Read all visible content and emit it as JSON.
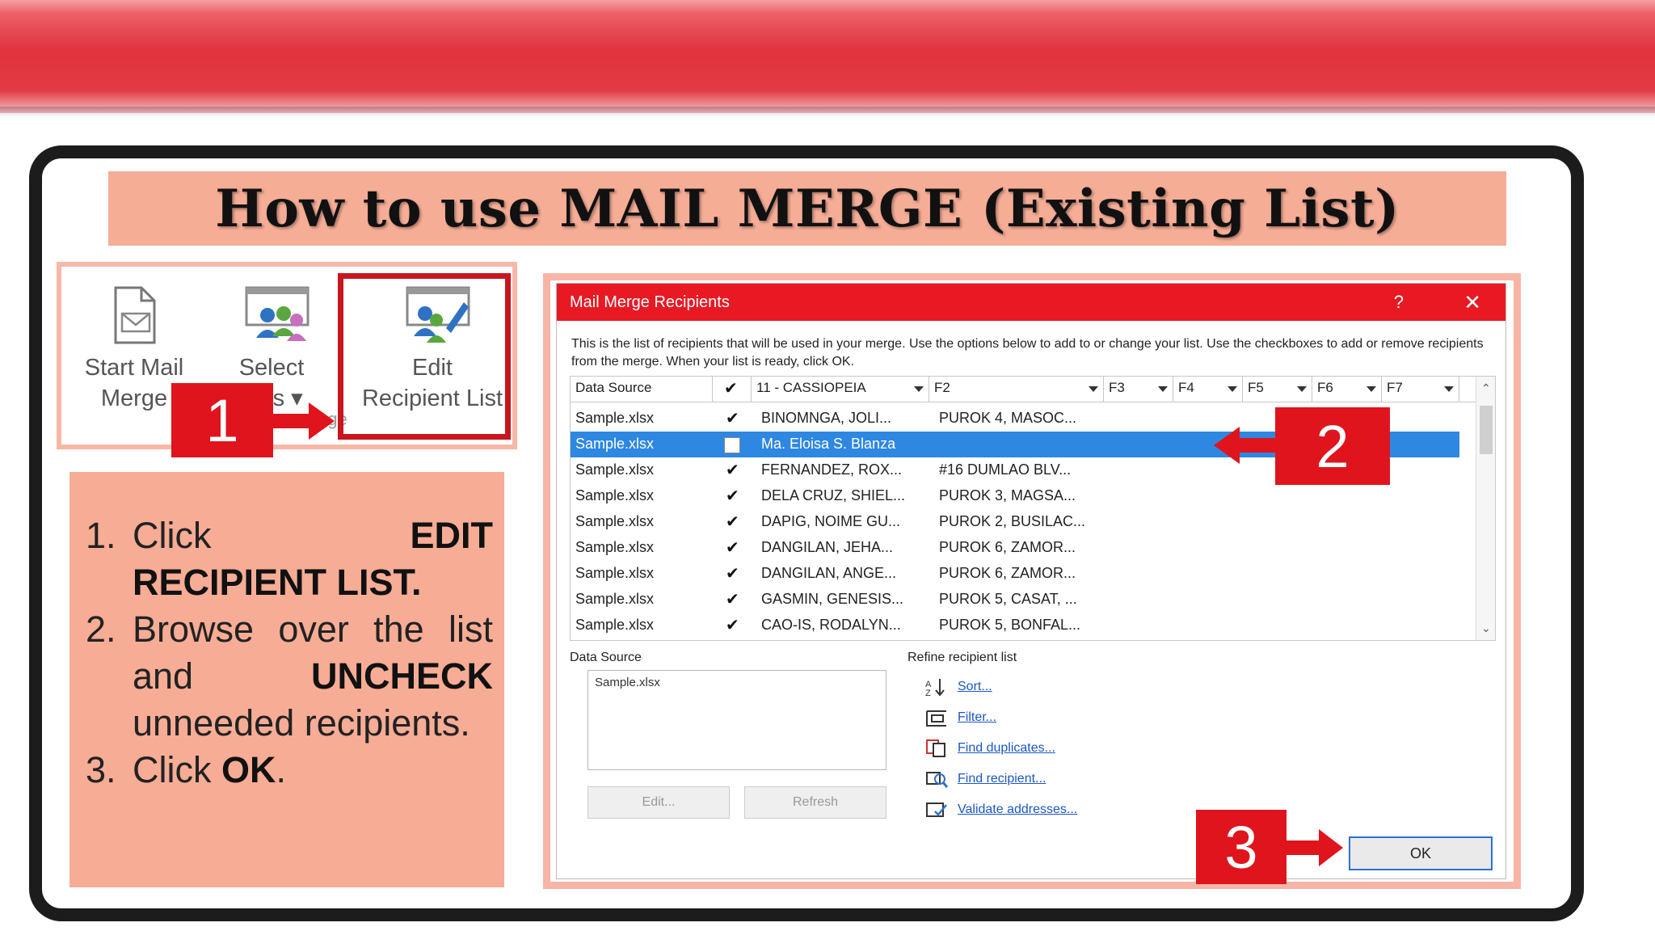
{
  "slide": {
    "title": "How to use MAIL MERGE (Existing List)"
  },
  "ribbon": {
    "start_mail_merge": [
      "Start Mail",
      "Merge"
    ],
    "select_recipients": [
      "Select",
      "ents ▾"
    ],
    "edit_recipient_list": [
      "Edit",
      "Recipient List"
    ],
    "group_label": "rge"
  },
  "callouts": {
    "one": "1",
    "two": "2",
    "three": "3"
  },
  "steps": [
    {
      "num": "1.",
      "pre": "Click ",
      "bold": "EDIT RECIPIENT LIST.",
      "post": ""
    },
    {
      "num": "2.",
      "pre": "Browse over the list and ",
      "bold": "UNCHECK",
      "post": " unneeded recipients."
    },
    {
      "num": "3.",
      "pre": "Click ",
      "bold": "OK",
      "post": "."
    }
  ],
  "dialog": {
    "title": "Mail Merge Recipients",
    "help": "?",
    "close": "✕",
    "instructions": "This is the list of recipients that will be used in your merge.  Use the options below to add to or change your list.  Use the checkboxes to add or remove recipients from the merge.  When your list is ready, click OK.",
    "columns": [
      "Data Source",
      "",
      "11 - CASSIOPEIA",
      "F2",
      "F3",
      "F4",
      "F5",
      "F6",
      "F7"
    ],
    "rows": [
      {
        "source": "Sample.xlsx",
        "checked": true,
        "name": "BINOMNGA, JOLI...",
        "address": "PUROK 4, MASOC...",
        "selected": false
      },
      {
        "source": "Sample.xlsx",
        "checked": false,
        "name": "Ma. Eloisa S. Blanza",
        "address": "",
        "selected": true
      },
      {
        "source": "Sample.xlsx",
        "checked": true,
        "name": "FERNANDEZ, ROX...",
        "address": "#16 DUMLAO BLV...",
        "selected": false
      },
      {
        "source": "Sample.xlsx",
        "checked": true,
        "name": "DELA CRUZ, SHIEL...",
        "address": "PUROK 3, MAGSA...",
        "selected": false
      },
      {
        "source": "Sample.xlsx",
        "checked": true,
        "name": "DAPIG, NOIME GU...",
        "address": "PUROK 2, BUSILAC...",
        "selected": false
      },
      {
        "source": "Sample.xlsx",
        "checked": true,
        "name": "DANGILAN, JEHA...",
        "address": "PUROK 6, ZAMOR...",
        "selected": false
      },
      {
        "source": "Sample.xlsx",
        "checked": true,
        "name": "DANGILAN, ANGE...",
        "address": "PUROK 6, ZAMOR...",
        "selected": false
      },
      {
        "source": "Sample.xlsx",
        "checked": true,
        "name": "GASMIN, GENESIS...",
        "address": "PUROK 5, CASAT, ...",
        "selected": false
      },
      {
        "source": "Sample.xlsx",
        "checked": true,
        "name": "CAO-IS, RODALYN...",
        "address": "PUROK 5, BONFAL...",
        "selected": false
      }
    ],
    "data_source_label": "Data Source",
    "data_source_items": [
      "Sample.xlsx"
    ],
    "edit_button": "Edit...",
    "refresh_button": "Refresh",
    "refine_label": "Refine recipient list",
    "refine_links": [
      "Sort...",
      "Filter...",
      "Find duplicates...",
      "Find recipient...",
      "Validate addresses..."
    ],
    "ok_button": "OK"
  },
  "colors": {
    "banner_red": "#e0343e",
    "accent_red": "#e0141c",
    "salmon": "#f6ac95",
    "selection_blue": "#2e87e0",
    "link_blue": "#1a56c4"
  }
}
